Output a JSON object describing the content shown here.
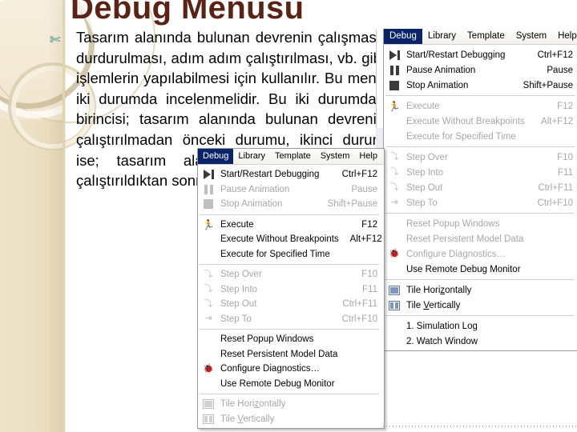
{
  "slide": {
    "title": "Debug Menüsü",
    "bullet_glyph": "✄",
    "body": "Tasarım alanında bulunan devrenin çalışması, durdurulması, adım adım çalıştırılması, vb. gibi işlemlerin yapılabilmesi için kullanılır. Bu menü iki durumda incelenmelidir. Bu iki durumdan birincisi; tasarım alanında bulunan devrenin çalıştırılmadan önceki durumu, ikinci durum ise; tasarım alanında bulunan devrenin çalıştırıldıktan sonraki durumudur.",
    "colors": {
      "title": "#5b2316",
      "sidebar": "#ece0c3",
      "bullet": "#2e8b84",
      "menu_highlight": "#0a246a"
    }
  },
  "menu_bar": {
    "items": [
      {
        "label": "Debug",
        "active": true
      },
      {
        "label": "Library",
        "active": false
      },
      {
        "label": "Template",
        "active": false
      },
      {
        "label": "System",
        "active": false
      },
      {
        "label": "Help",
        "active": false
      }
    ]
  },
  "menu_back": {
    "name": "debug-menu-running-state",
    "items": [
      {
        "label": "Start/Restart Debugging",
        "accel": "Ctrl+F12",
        "enabled": true,
        "icon": "play-icon"
      },
      {
        "label": "Pause Animation",
        "accel": "Pause",
        "enabled": true,
        "icon": "pause-icon"
      },
      {
        "label": "Stop Animation",
        "accel": "Shift+Pause",
        "enabled": true,
        "icon": "stop-icon"
      },
      {
        "separator": true
      },
      {
        "label": "Execute",
        "accel": "F12",
        "enabled": false,
        "icon": "run-icon"
      },
      {
        "label": "Execute Without Breakpoints",
        "accel": "Alt+F12",
        "enabled": false,
        "icon": ""
      },
      {
        "label": "Execute for Specified Time",
        "accel": "",
        "enabled": false,
        "icon": ""
      },
      {
        "separator": true
      },
      {
        "label": "Step Over",
        "accel": "F10",
        "enabled": false,
        "icon": "step-over-icon"
      },
      {
        "label": "Step Into",
        "accel": "F11",
        "enabled": false,
        "icon": "step-into-icon"
      },
      {
        "label": "Step Out",
        "accel": "Ctrl+F11",
        "enabled": false,
        "icon": "step-out-icon"
      },
      {
        "label": "Step To",
        "accel": "Ctrl+F10",
        "enabled": false,
        "icon": "step-to-icon"
      },
      {
        "separator": true
      },
      {
        "label": "Reset Popup Windows",
        "accel": "",
        "enabled": false,
        "icon": ""
      },
      {
        "label": "Reset Persistent Model Data",
        "accel": "",
        "enabled": false,
        "icon": ""
      },
      {
        "label": "Configure Diagnostics…",
        "accel": "",
        "enabled": false,
        "icon": "bug-icon"
      },
      {
        "label": "Use Remote Debug Monitor",
        "accel": "",
        "enabled": true,
        "icon": ""
      },
      {
        "separator": true
      },
      {
        "label": "Tile Horizontally",
        "accel": "",
        "enabled": true,
        "icon": "tile-horizontal-icon",
        "accel_key": "z"
      },
      {
        "label": "Tile Vertically",
        "accel": "",
        "enabled": true,
        "icon": "tile-vertical-icon",
        "accel_key": "V"
      },
      {
        "separator": true
      },
      {
        "label": "1. Simulation Log",
        "accel": "",
        "enabled": true,
        "icon": ""
      },
      {
        "label": "2. Watch Window",
        "accel": "",
        "enabled": true,
        "icon": ""
      }
    ]
  },
  "menu_front": {
    "name": "debug-menu-stopped-state",
    "items": [
      {
        "label": "Start/Restart Debugging",
        "accel": "Ctrl+F12",
        "enabled": true,
        "icon": "play-icon"
      },
      {
        "label": "Pause Animation",
        "accel": "Pause",
        "enabled": false,
        "icon": "pause-icon"
      },
      {
        "label": "Stop Animation",
        "accel": "Shift+Pause",
        "enabled": false,
        "icon": "stop-icon"
      },
      {
        "separator": true
      },
      {
        "label": "Execute",
        "accel": "F12",
        "enabled": true,
        "icon": "run-icon"
      },
      {
        "label": "Execute Without Breakpoints",
        "accel": "Alt+F12",
        "enabled": true,
        "icon": ""
      },
      {
        "label": "Execute for Specified Time",
        "accel": "",
        "enabled": true,
        "icon": ""
      },
      {
        "separator": true
      },
      {
        "label": "Step Over",
        "accel": "F10",
        "enabled": false,
        "icon": "step-over-icon"
      },
      {
        "label": "Step Into",
        "accel": "F11",
        "enabled": false,
        "icon": "step-into-icon"
      },
      {
        "label": "Step Out",
        "accel": "Ctrl+F11",
        "enabled": false,
        "icon": "step-out-icon"
      },
      {
        "label": "Step To",
        "accel": "Ctrl+F10",
        "enabled": false,
        "icon": "step-to-icon"
      },
      {
        "separator": true
      },
      {
        "label": "Reset Popup Windows",
        "accel": "",
        "enabled": true,
        "icon": ""
      },
      {
        "label": "Reset Persistent Model Data",
        "accel": "",
        "enabled": true,
        "icon": ""
      },
      {
        "label": "Configure Diagnostics…",
        "accel": "",
        "enabled": true,
        "icon": "bug-icon"
      },
      {
        "label": "Use Remote Debug Monitor",
        "accel": "",
        "enabled": true,
        "icon": ""
      },
      {
        "separator": true
      },
      {
        "label": "Tile Horizontally",
        "accel": "",
        "enabled": false,
        "icon": "tile-horizontal-icon",
        "accel_key": "z"
      },
      {
        "label": "Tile Vertically",
        "accel": "",
        "enabled": false,
        "icon": "tile-vertical-icon",
        "accel_key": "V"
      }
    ]
  }
}
